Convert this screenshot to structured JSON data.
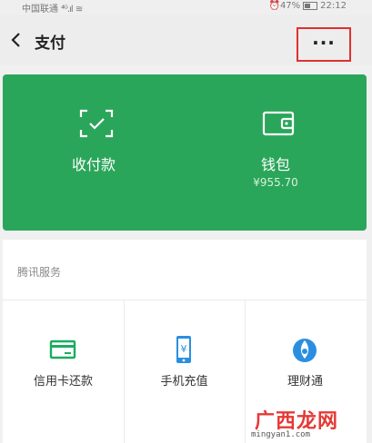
{
  "status_bar": {
    "carrier": "中国联通",
    "network": "4G",
    "battery": "47%",
    "time": "22:12"
  },
  "header": {
    "back_icon": "chevron-left-icon",
    "title": "支付",
    "more_label": "···"
  },
  "wallet_card": {
    "background": "#2aa65a",
    "receive_pay": {
      "label": "收付款",
      "icon": "scan-check-icon"
    },
    "wallet": {
      "label": "钱包",
      "balance": "¥955.70",
      "icon": "wallet-icon"
    }
  },
  "services": {
    "section_title": "腾讯服务",
    "items": [
      {
        "label": "信用卡还款",
        "icon": "credit-card-icon",
        "color": "#1aad5f"
      },
      {
        "label": "手机充值",
        "icon": "phone-recharge-icon",
        "color": "#2a8fe0"
      },
      {
        "label": "理财通",
        "icon": "licaitong-icon",
        "color": "#2a8fe0"
      }
    ]
  },
  "watermark": {
    "logo_text": "广西龙网",
    "url": "mingyan1.com"
  }
}
